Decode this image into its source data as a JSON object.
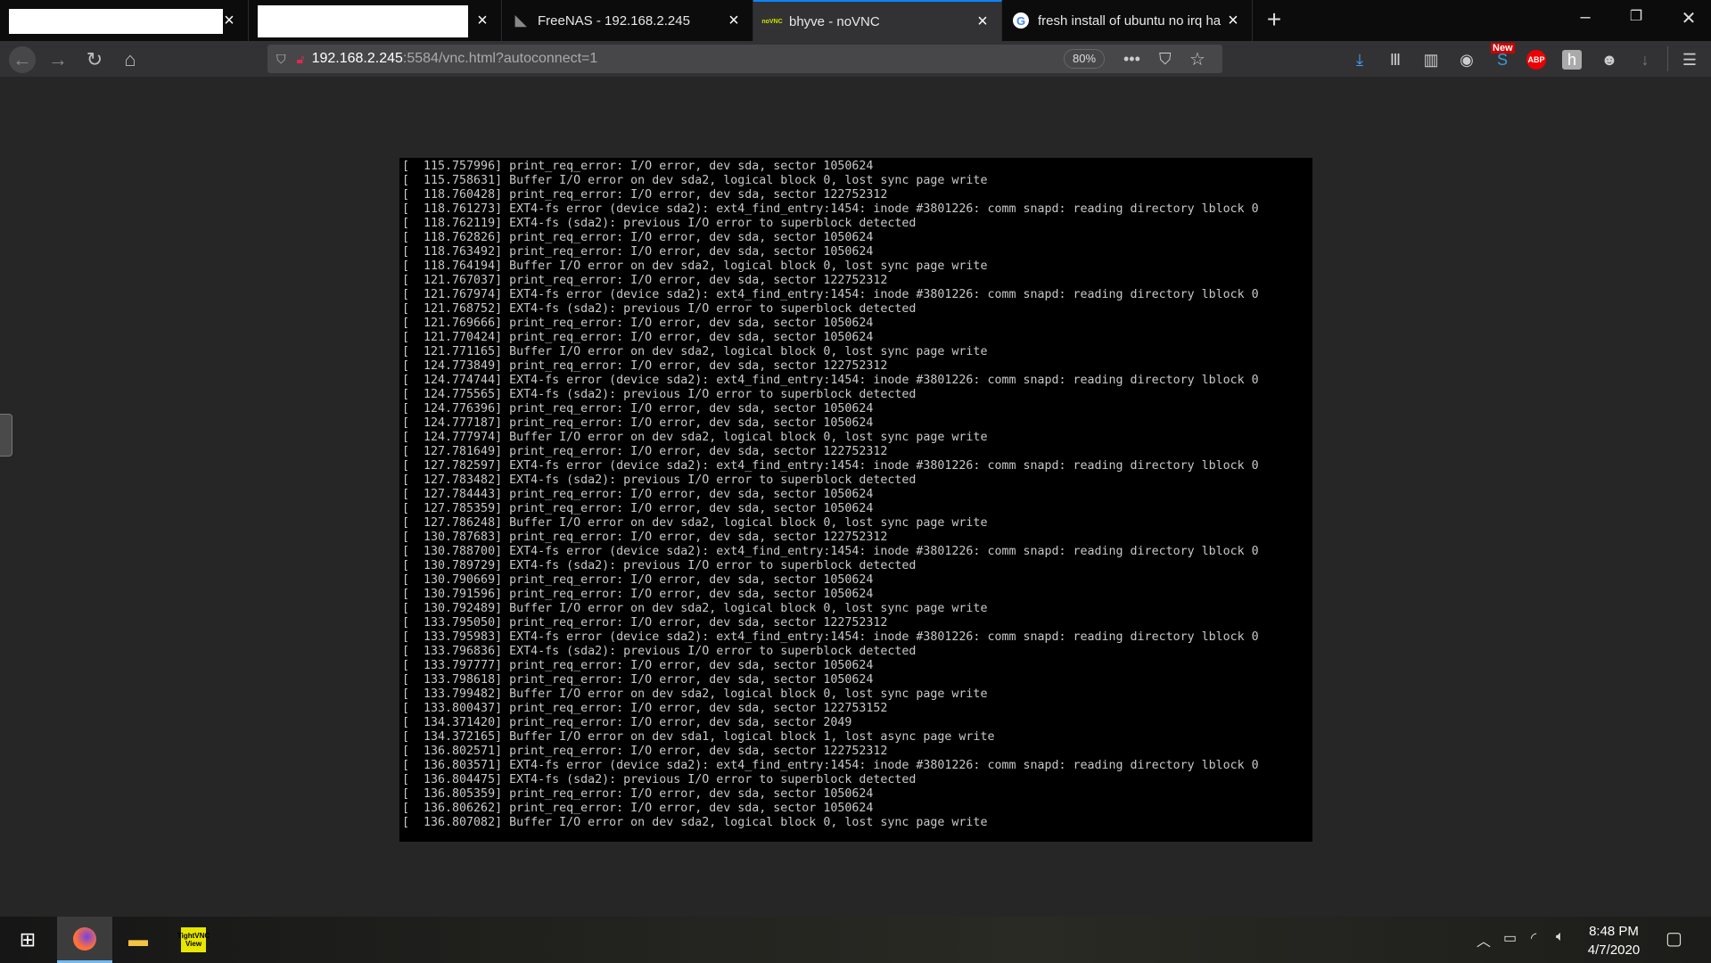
{
  "browser": {
    "tabs": [
      {
        "title": "",
        "redacted": true
      },
      {
        "title": "",
        "redacted": true
      },
      {
        "title": "FreeNAS - 192.168.2.245",
        "icon": "freenas-icon"
      },
      {
        "title": "bhyve - noVNC",
        "icon": "novnc-icon",
        "favicon_text": "noVNC",
        "active": true
      },
      {
        "title": "fresh install of ubuntu no irq ha",
        "icon": "google-icon",
        "favicon_text": "G"
      }
    ],
    "new_tab": "+",
    "url_host": "192.168.2.245",
    "url_path": ":5584/vnc.html?autoconnect=1",
    "zoom": "80%",
    "new_badge": "New",
    "abp": "ABP",
    "accent": "#0a84ff"
  },
  "terminal": {
    "lines": [
      "[  115.757996] print_req_error: I/O error, dev sda, sector 1050624",
      "[  115.758631] Buffer I/O error on dev sda2, logical block 0, lost sync page write",
      "[  118.760428] print_req_error: I/O error, dev sda, sector 122752312",
      "[  118.761273] EXT4-fs error (device sda2): ext4_find_entry:1454: inode #3801226: comm snapd: reading directory lblock 0",
      "[  118.762119] EXT4-fs (sda2): previous I/O error to superblock detected",
      "[  118.762826] print_req_error: I/O error, dev sda, sector 1050624",
      "[  118.763492] print_req_error: I/O error, dev sda, sector 1050624",
      "[  118.764194] Buffer I/O error on dev sda2, logical block 0, lost sync page write",
      "[  121.767037] print_req_error: I/O error, dev sda, sector 122752312",
      "[  121.767974] EXT4-fs error (device sda2): ext4_find_entry:1454: inode #3801226: comm snapd: reading directory lblock 0",
      "[  121.768752] EXT4-fs (sda2): previous I/O error to superblock detected",
      "[  121.769666] print_req_error: I/O error, dev sda, sector 1050624",
      "[  121.770424] print_req_error: I/O error, dev sda, sector 1050624",
      "[  121.771165] Buffer I/O error on dev sda2, logical block 0, lost sync page write",
      "[  124.773849] print_req_error: I/O error, dev sda, sector 122752312",
      "[  124.774744] EXT4-fs error (device sda2): ext4_find_entry:1454: inode #3801226: comm snapd: reading directory lblock 0",
      "[  124.775565] EXT4-fs (sda2): previous I/O error to superblock detected",
      "[  124.776396] print_req_error: I/O error, dev sda, sector 1050624",
      "[  124.777187] print_req_error: I/O error, dev sda, sector 1050624",
      "[  124.777974] Buffer I/O error on dev sda2, logical block 0, lost sync page write",
      "[  127.781649] print_req_error: I/O error, dev sda, sector 122752312",
      "[  127.782597] EXT4-fs error (device sda2): ext4_find_entry:1454: inode #3801226: comm snapd: reading directory lblock 0",
      "[  127.783482] EXT4-fs (sda2): previous I/O error to superblock detected",
      "[  127.784443] print_req_error: I/O error, dev sda, sector 1050624",
      "[  127.785359] print_req_error: I/O error, dev sda, sector 1050624",
      "[  127.786248] Buffer I/O error on dev sda2, logical block 0, lost sync page write",
      "[  130.787683] print_req_error: I/O error, dev sda, sector 122752312",
      "[  130.788700] EXT4-fs error (device sda2): ext4_find_entry:1454: inode #3801226: comm snapd: reading directory lblock 0",
      "[  130.789729] EXT4-fs (sda2): previous I/O error to superblock detected",
      "[  130.790669] print_req_error: I/O error, dev sda, sector 1050624",
      "[  130.791596] print_req_error: I/O error, dev sda, sector 1050624",
      "[  130.792489] Buffer I/O error on dev sda2, logical block 0, lost sync page write",
      "[  133.795050] print_req_error: I/O error, dev sda, sector 122752312",
      "[  133.795983] EXT4-fs error (device sda2): ext4_find_entry:1454: inode #3801226: comm snapd: reading directory lblock 0",
      "[  133.796836] EXT4-fs (sda2): previous I/O error to superblock detected",
      "[  133.797777] print_req_error: I/O error, dev sda, sector 1050624",
      "[  133.798618] print_req_error: I/O error, dev sda, sector 1050624",
      "[  133.799482] Buffer I/O error on dev sda2, logical block 0, lost sync page write",
      "[  133.800437] print_req_error: I/O error, dev sda, sector 122753152",
      "[  134.371420] print_req_error: I/O error, dev sda, sector 2049",
      "[  134.372165] Buffer I/O error on dev sda1, logical block 1, lost async page write",
      "[  136.802571] print_req_error: I/O error, dev sda, sector 122752312",
      "[  136.803571] EXT4-fs error (device sda2): ext4_find_entry:1454: inode #3801226: comm snapd: reading directory lblock 0",
      "[  136.804475] EXT4-fs (sda2): previous I/O error to superblock detected",
      "[  136.805359] print_req_error: I/O error, dev sda, sector 1050624",
      "[  136.806262] print_req_error: I/O error, dev sda, sector 1050624",
      "[  136.807082] Buffer I/O error on dev sda2, logical block 0, lost sync page write"
    ]
  },
  "taskbar": {
    "time": "8:48 PM",
    "date": "4/7/2020",
    "vnc_icon_text": "TightVNC View"
  }
}
